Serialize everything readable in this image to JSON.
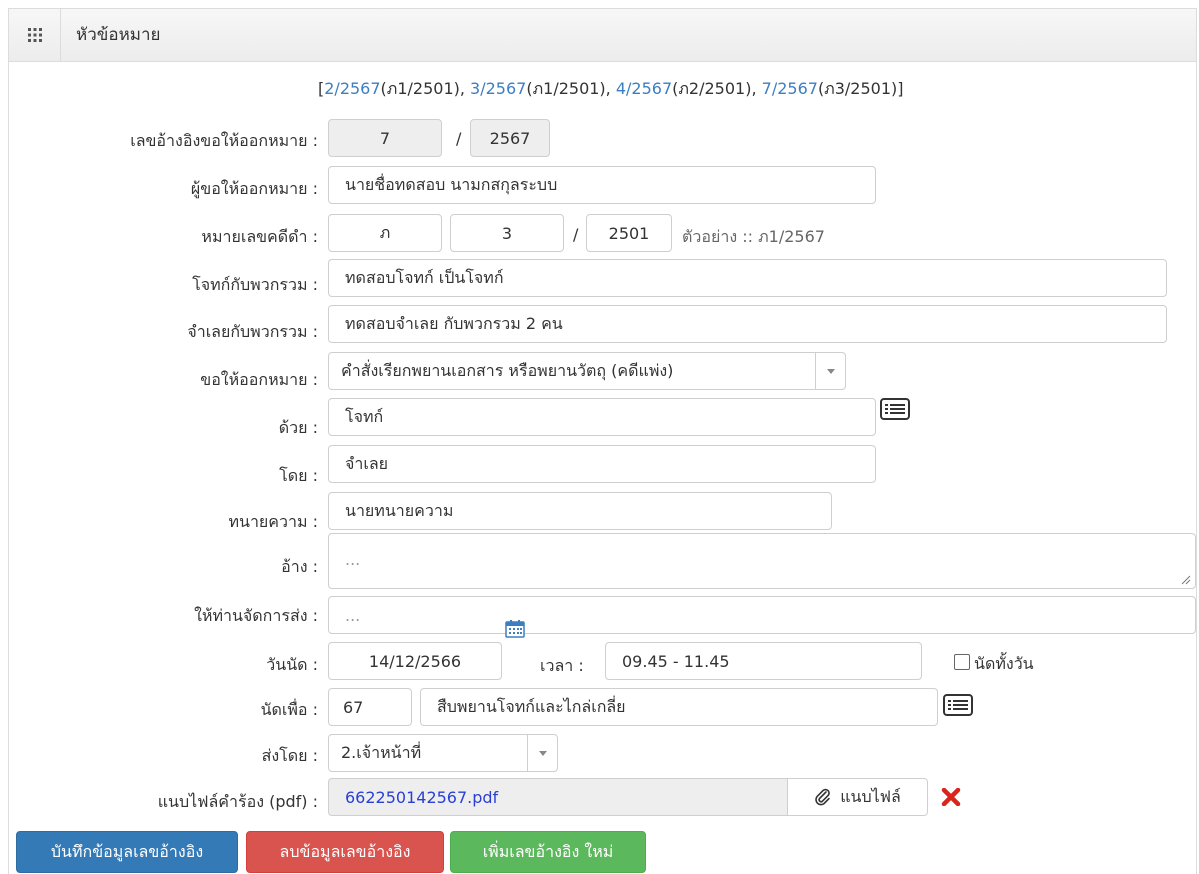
{
  "header": {
    "title": "หัวข้อหมาย",
    "icon": "grid-icon"
  },
  "references": {
    "open_bracket": "[",
    "close_bracket": "]",
    "items": [
      {
        "link": "2/2567",
        "case": "(ภ1/2501)",
        "sep": ", "
      },
      {
        "link": "3/2567",
        "case": "(ภ1/2501)",
        "sep": ", "
      },
      {
        "link": "4/2567",
        "case": "(ภ2/2501)",
        "sep": ", "
      },
      {
        "link": "7/2567",
        "case": "(ภ3/2501)",
        "sep": ""
      }
    ]
  },
  "form": {
    "ref_no": {
      "label": "เลขอ้างอิงขอให้ออกหมาย :",
      "number": "7",
      "slash": "/",
      "year": "2567"
    },
    "requester": {
      "label": "ผู้ขอให้ออกหมาย :",
      "value": "นายชื่อทดสอบ นามกสกุลระบบ"
    },
    "black_case": {
      "label": "หมายเลขคดีดำ :",
      "prefix": "ภ",
      "number": "3",
      "slash": "/",
      "year": "2501",
      "example": "ตัวอย่าง :: ภ1/2567"
    },
    "plaintiff": {
      "label": "โจทก์กับพวกรวม :",
      "value": "ทดสอบโจทก์ เป็นโจทก์"
    },
    "defendant": {
      "label": "จำเลยกับพวกรวม :",
      "value": "ทดสอบจำเลย กับพวกรวม 2 คน"
    },
    "request_warrant": {
      "label": "ขอให้ออกหมาย :",
      "selected": "คำสั่งเรียกพยานเอกสาร หรือพยานวัตถุ (คดีแพ่ง)"
    },
    "with": {
      "label": "ด้วย :",
      "value": "โจทก์"
    },
    "by": {
      "label": "โดย :",
      "value": "จำเลย"
    },
    "lawyer": {
      "label": "ทนายความ :",
      "value": "นายทนายความ"
    },
    "refer": {
      "label": "อ้าง :",
      "placeholder": "..."
    },
    "delivery_manage": {
      "label": "ให้ท่านจัดการส่ง :",
      "placeholder": "..."
    },
    "appointment": {
      "label": "วันนัด :",
      "date": "14/12/2566",
      "time_label": "เวลา :",
      "time": "09.45 - 11.45",
      "all_day_label": "นัดทั้งวัน",
      "all_day_checked": false
    },
    "appointment_for": {
      "label": "นัดเพื่อ :",
      "code": "67",
      "value": "สืบพยานโจทก์และไกล่เกลี่ย"
    },
    "send_by": {
      "label": "ส่งโดย :",
      "selected": "2.เจ้าหน้าที่"
    },
    "attachment": {
      "label": "แนบไฟล์คำร้อง (pdf) :",
      "file_name": "662250142567.pdf",
      "attach_label": "แนบไฟล์"
    }
  },
  "buttons": {
    "save": "บันทึกข้อมูลเลขอ้างอิง",
    "delete": "ลบข้อมูลเลขอ้างอิง",
    "add_new": "เพิ่มเลขอ้างอิง ใหม่"
  },
  "colors": {
    "link": "#3c7ec0",
    "primary": "#337ab7",
    "danger": "#d9534f",
    "success": "#5cb85c",
    "delete_icon": "#d9251c"
  }
}
